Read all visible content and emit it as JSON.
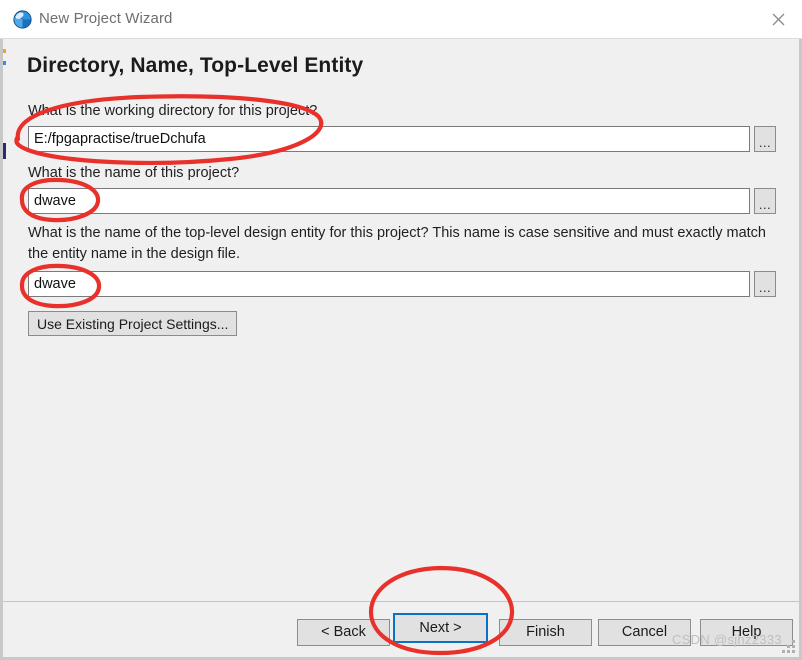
{
  "window": {
    "title": "New Project Wizard",
    "icon": "quartus-globe-icon",
    "close_label": "close-icon"
  },
  "page": {
    "heading": "Directory, Name, Top-Level Entity"
  },
  "fields": [
    {
      "name": "working-directory",
      "question": "What is the working directory for this project?",
      "value": "E:/fpgapractise/trueDchufa",
      "placeholder": "",
      "browse_label": "...",
      "browse_icon": "ellipsis-icon"
    },
    {
      "name": "project-name",
      "question": "What is the name of this project?",
      "value": "dwave",
      "placeholder": "",
      "browse_label": "...",
      "browse_icon": "ellipsis-icon"
    },
    {
      "name": "top-level-entity",
      "question": "What is the name of the top-level design entity for this project? This name is case sensitive and must exactly match the entity name in the design file.",
      "value": "dwave",
      "placeholder": "",
      "browse_label": "...",
      "browse_icon": "ellipsis-icon"
    }
  ],
  "existing_settings": {
    "label": "Use Existing Project Settings..."
  },
  "buttons": {
    "back": "< Back",
    "next": "Next >",
    "finish": "Finish",
    "cancel": "Cancel",
    "help": "Help"
  },
  "watermark": "CSDN @sjhz2333",
  "colors": {
    "dialog_bg": "#f0f0f0",
    "titlebar_bg": "#ffffff",
    "title_text": "#6e6e6e",
    "button_face": "#e1e1e1",
    "button_border": "#8d8d8d",
    "input_bg": "#ffffff",
    "input_border": "#7a7a7a",
    "focus_blue": "#0a72c4",
    "annotation_red": "#e8312a",
    "watermark_gray": "#c3bfbb"
  },
  "annotations": [
    {
      "name": "ellipse-working-directory",
      "target": "working-directory-field"
    },
    {
      "name": "ellipse-project-name",
      "target": "project-name-field"
    },
    {
      "name": "ellipse-top-level-entity",
      "target": "top-level-entity-field"
    },
    {
      "name": "ellipse-next-button",
      "target": "next-button"
    }
  ]
}
